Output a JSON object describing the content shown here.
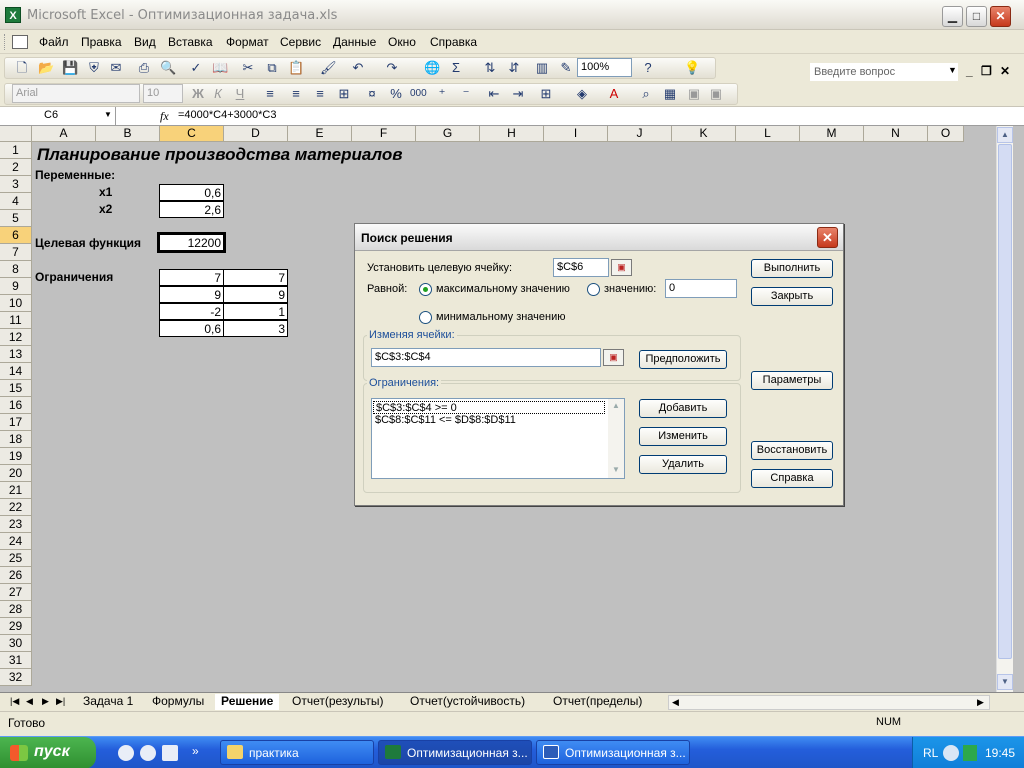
{
  "window": {
    "title": "Microsoft Excel - Оптимизационная задача.xls",
    "app_icon_letter": "X"
  },
  "menu": {
    "items": [
      "Файл",
      "Правка",
      "Вид",
      "Вставка",
      "Формат",
      "Сервис",
      "Данные",
      "Окно",
      "Справка"
    ],
    "ask_placeholder": "Введите вопрос"
  },
  "toolbar": {
    "zoom": "100%",
    "font_name": "Arial",
    "font_size": "10"
  },
  "formula_bar": {
    "name_box": "C6",
    "fx": "fx",
    "formula": "=4000*C4+3000*C3"
  },
  "columns": [
    "A",
    "B",
    "C",
    "D",
    "E",
    "F",
    "G",
    "H",
    "I",
    "J",
    "K",
    "L",
    "M",
    "N",
    "O"
  ],
  "rows": [
    "1",
    "2",
    "3",
    "4",
    "5",
    "6",
    "7",
    "8",
    "9",
    "10",
    "11",
    "12",
    "13",
    "14",
    "15",
    "16",
    "17",
    "18",
    "19",
    "20",
    "21",
    "22",
    "23",
    "24",
    "25",
    "26",
    "27",
    "28",
    "29",
    "30",
    "31",
    "32"
  ],
  "sheet": {
    "title": "Планирование производства материалов",
    "variables_label": "Переменные:",
    "x1_label": "x1",
    "x1_value": "0,6",
    "x2_label": "x2",
    "x2_value": "2,6",
    "objective_label": "Целевая функция",
    "objective_value": "12200",
    "constraints_label": "Ограничения",
    "constraints": [
      {
        "c": "7",
        "d": "7"
      },
      {
        "c": "9",
        "d": "9"
      },
      {
        "c": "-2",
        "d": "1"
      },
      {
        "c": "0,6",
        "d": "3"
      }
    ]
  },
  "tabs": [
    "Задача 1",
    "Формулы",
    "Решение",
    "Отчет(результы)",
    "Отчет(устойчивость)",
    "Отчет(пределы)"
  ],
  "active_tab": "Решение",
  "status": {
    "ready": "Готово",
    "num": "NUM"
  },
  "dialog": {
    "title": "Поиск решения",
    "target_label": "Установить целевую ячейку:",
    "target_value": "$C$6",
    "equal_label": "Равной:",
    "radio_max": "максимальному значению",
    "radio_value": "значению:",
    "value_input": "0",
    "radio_min": "минимальному значению",
    "changing_group": "Изменяя ячейки:",
    "changing_value": "$C$3:$C$4",
    "constraints_group": "Ограничения:",
    "constraints_list": [
      "$C$3:$C$4 >= 0",
      "$C$8:$C$11 <= $D$8:$D$11"
    ],
    "btn_solve": "Выполнить",
    "btn_close": "Закрыть",
    "btn_guess": "Предположить",
    "btn_options": "Параметры",
    "btn_add": "Добавить",
    "btn_change": "Изменить",
    "btn_delete": "Удалить",
    "btn_reset": "Восстановить",
    "btn_help": "Справка"
  },
  "taskbar": {
    "start": "пуск",
    "tasks": [
      "практика",
      "Оптимизационная з...",
      "Оптимизационная з..."
    ],
    "lang": "RL",
    "clock": "19:45"
  }
}
